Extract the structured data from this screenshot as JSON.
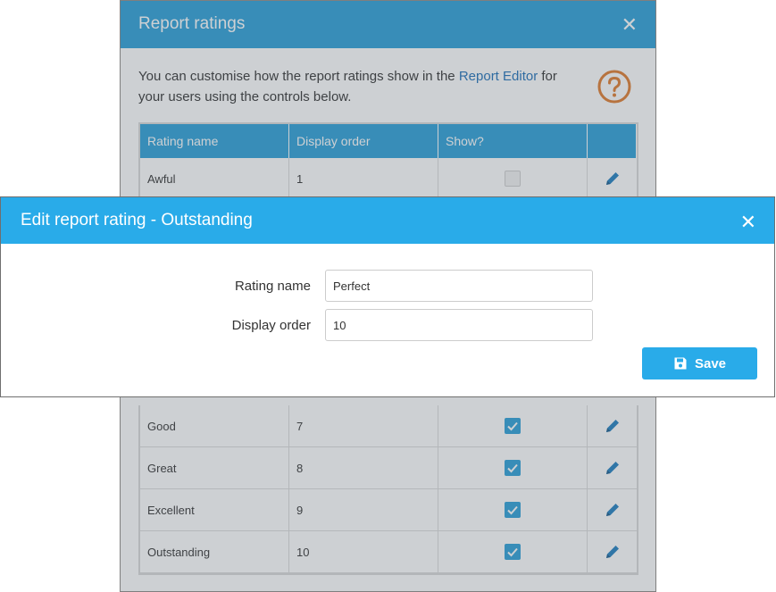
{
  "background_dialog": {
    "title": "Report ratings",
    "close_glyph": "✕",
    "intro_before": "You can customise how the report ratings show in the ",
    "intro_link": "Report Editor",
    "intro_after": " for your users using the controls below.",
    "help_icon": "question-circle-icon",
    "table": {
      "headers": [
        "Rating name",
        "Display order",
        "Show?",
        ""
      ],
      "top_rows": [
        {
          "name": "Awful",
          "order": "1",
          "show": false
        }
      ],
      "bottom_rows": [
        {
          "name": "Good",
          "order": "7",
          "show": true
        },
        {
          "name": "Great",
          "order": "8",
          "show": true
        },
        {
          "name": "Excellent",
          "order": "9",
          "show": true
        },
        {
          "name": "Outstanding",
          "order": "10",
          "show": true
        }
      ]
    }
  },
  "edit_modal": {
    "title": "Edit report rating - Outstanding",
    "close_glyph": "✕",
    "rating_name_label": "Rating name",
    "rating_name_value": "Perfect",
    "display_order_label": "Display order",
    "display_order_value": "10",
    "save_label": "Save",
    "save_icon": "floppy-disk-icon"
  },
  "colors": {
    "header_blue": "#2a9fd8",
    "modal_blue": "#29abe9",
    "link_blue": "#1e6fb8",
    "help_orange": "#e07a2c",
    "pencil_blue": "#1f7fc1"
  }
}
